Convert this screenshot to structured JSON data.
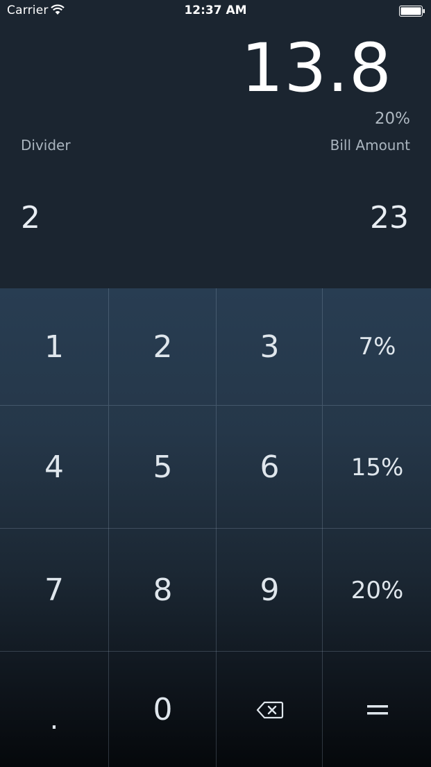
{
  "status_bar": {
    "carrier": "Carrier",
    "time": "12:37 AM",
    "wifi_icon": "wifi-icon",
    "battery_icon": "battery-icon"
  },
  "display": {
    "result": "13.8",
    "tip_percent": "20%",
    "divider_label": "Divider",
    "bill_label": "Bill Amount",
    "divider_value": "2",
    "bill_value": "23"
  },
  "keypad": {
    "row1": [
      "1",
      "2",
      "3",
      "7%"
    ],
    "row2": [
      "4",
      "5",
      "6",
      "15%"
    ],
    "row3": [
      "7",
      "8",
      "9",
      "20%"
    ],
    "row4": {
      "decimal": ".",
      "zero": "0",
      "backspace_icon": "backspace-icon",
      "equals_icon": "equals-icon"
    }
  },
  "colors": {
    "background": "#1b2530",
    "keypad_top": "#283d52",
    "keypad_bottom": "#05080b",
    "text": "#e9eef3",
    "muted_text": "#aab5bf"
  }
}
